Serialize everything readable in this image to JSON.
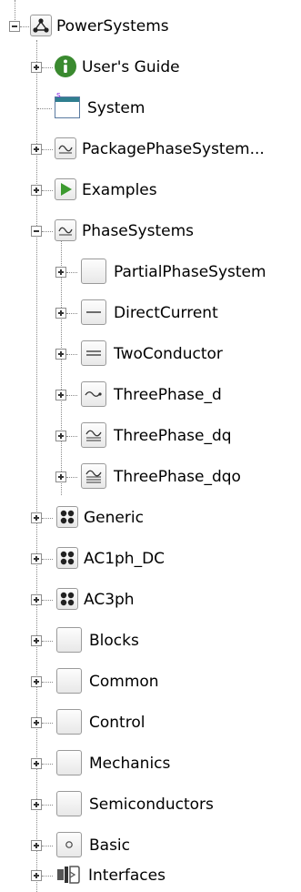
{
  "tree": {
    "root": {
      "label": "PowerSystems",
      "icon": "network-icon",
      "expanded": true
    },
    "level1": [
      {
        "label": "User's Guide",
        "icon": "info-icon",
        "expanded": false
      },
      {
        "label": "System",
        "icon": "system-window-icon",
        "expanded": null
      },
      {
        "label": "PackagePhaseSystem...",
        "icon": "ac-wave-icon",
        "expanded": false
      },
      {
        "label": "Examples",
        "icon": "play-icon",
        "expanded": false
      },
      {
        "label": "PhaseSystems",
        "icon": "ac-wave-icon",
        "expanded": true
      }
    ],
    "phase_children": [
      {
        "label": "PartialPhaseSystem",
        "icon": "package-icon"
      },
      {
        "label": "DirectCurrent",
        "icon": "single-line-icon"
      },
      {
        "label": "TwoConductor",
        "icon": "double-line-icon"
      },
      {
        "label": "ThreePhase_d",
        "icon": "wave-small-icon"
      },
      {
        "label": "ThreePhase_dq",
        "icon": "wave-double-icon"
      },
      {
        "label": "ThreePhase_dqo",
        "icon": "wave-triple-icon"
      }
    ],
    "level1_rest": [
      {
        "label": "Generic",
        "icon": "dots-grid-icon"
      },
      {
        "label": "AC1ph_DC",
        "icon": "dots-grid-icon"
      },
      {
        "label": "AC3ph",
        "icon": "dots-grid-icon"
      },
      {
        "label": "Blocks",
        "icon": "package-icon"
      },
      {
        "label": "Common",
        "icon": "package-icon"
      },
      {
        "label": "Control",
        "icon": "package-icon"
      },
      {
        "label": "Mechanics",
        "icon": "package-icon"
      },
      {
        "label": "Semiconductors",
        "icon": "package-icon"
      },
      {
        "label": "Basic",
        "icon": "circle-package-icon"
      },
      {
        "label": "Interfaces",
        "icon": "connector-icon"
      }
    ]
  }
}
